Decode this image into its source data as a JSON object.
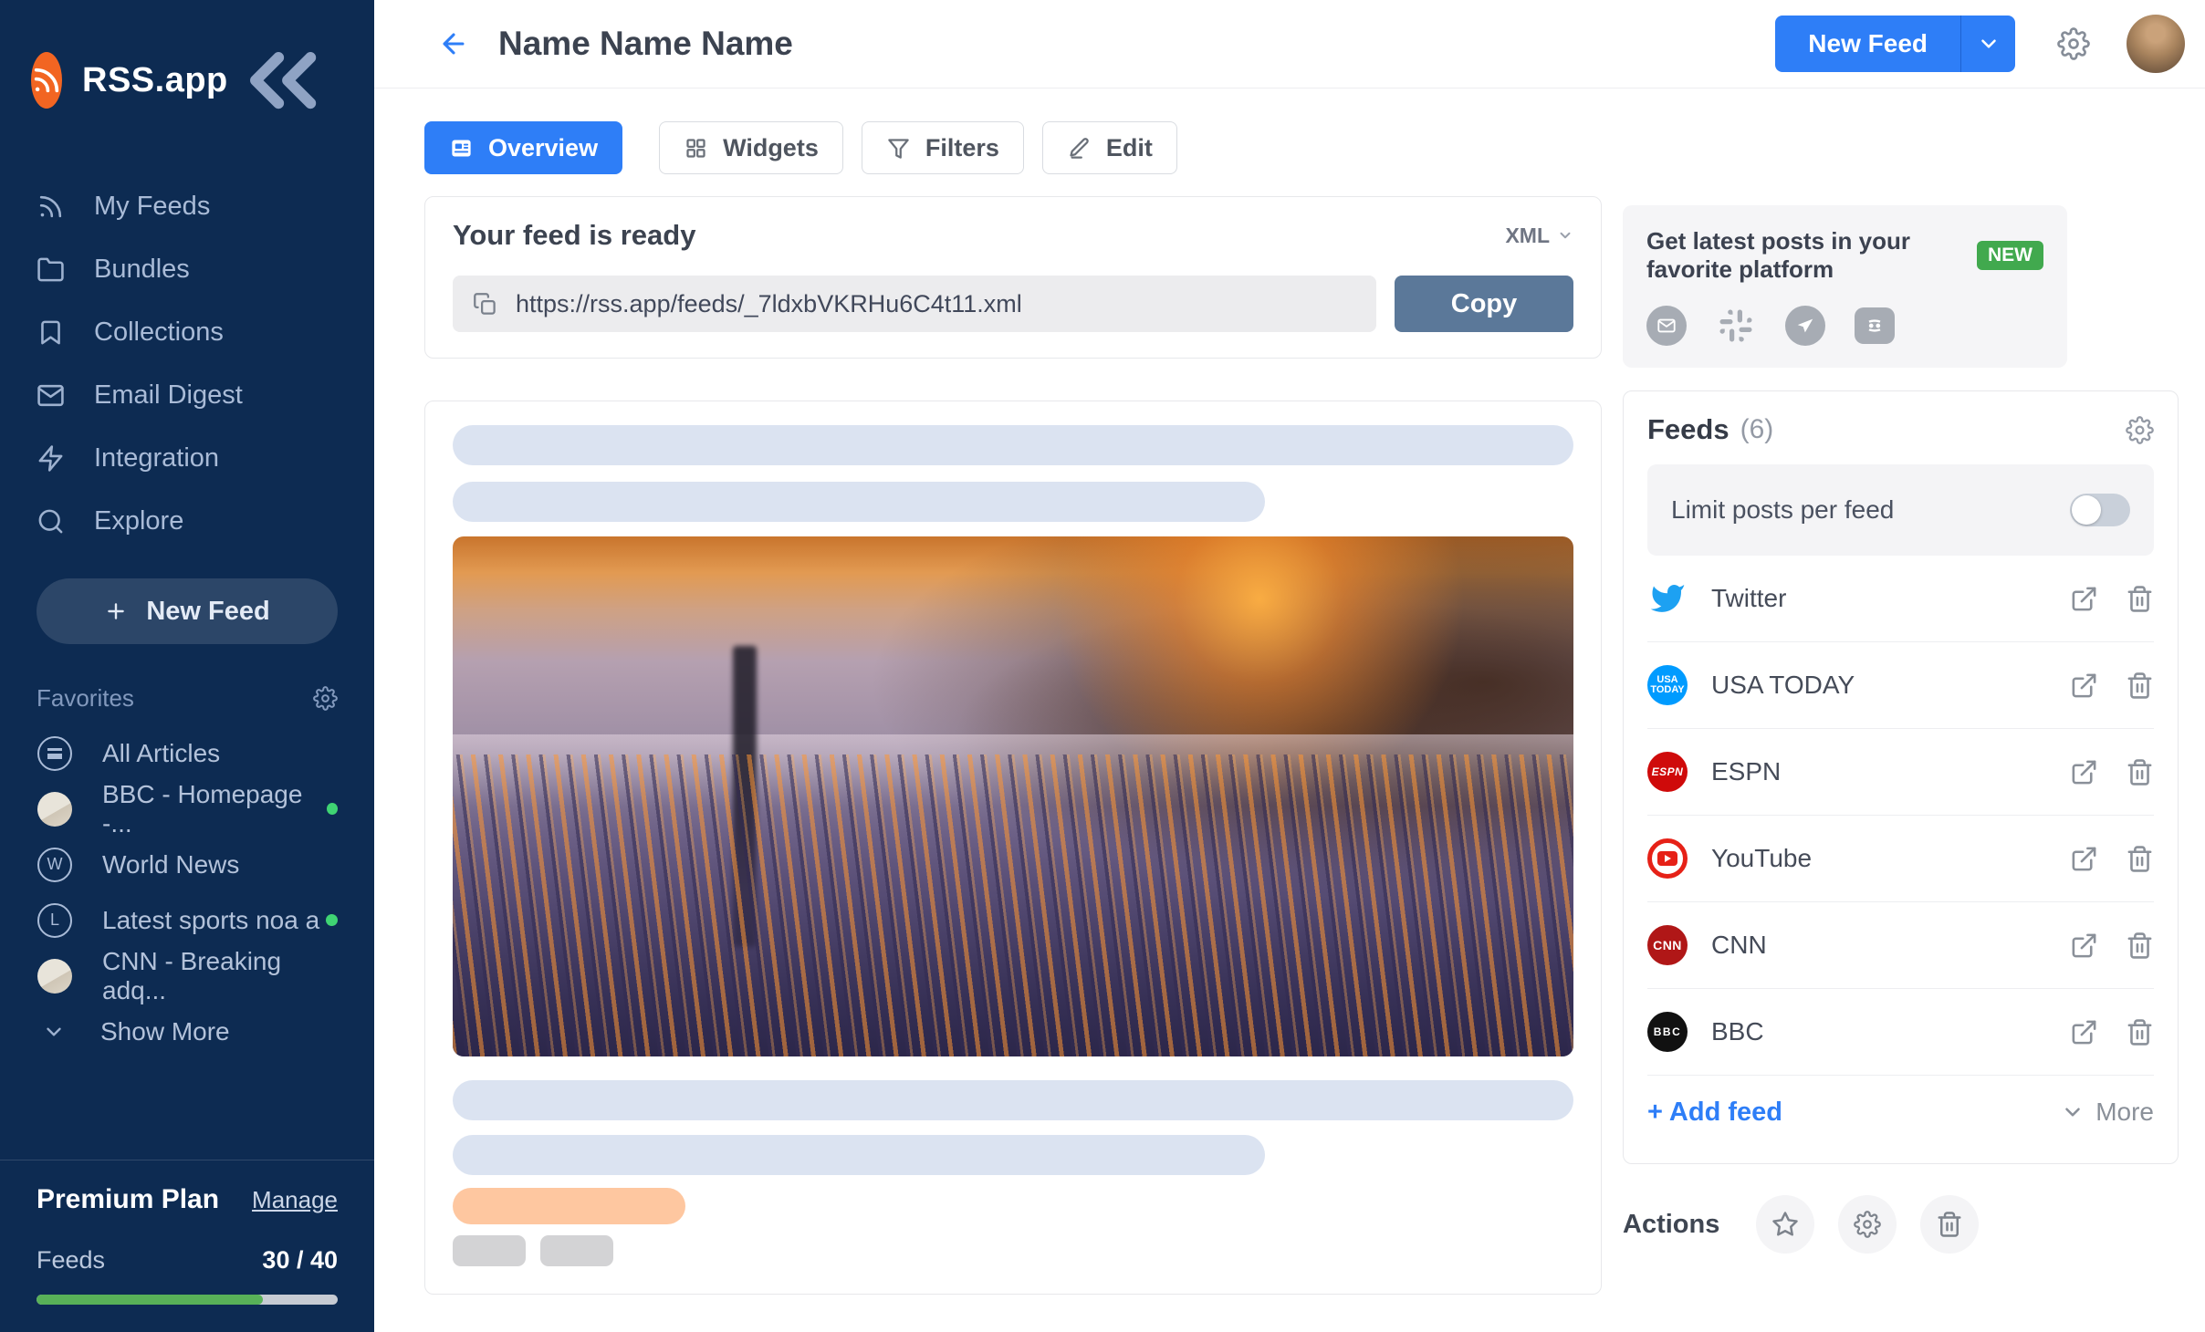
{
  "colors": {
    "accent": "#2e7ef7",
    "sidebar_bg": "#0d2b52",
    "copy_button": "#5b7899",
    "new_badge": "#41a94e",
    "progress_fill": "#58b158",
    "green_dot": "#3fd473"
  },
  "sidebar": {
    "logo_text": "RSS.app",
    "logo_icon": "rss-icon",
    "collapse_icon": "chevrons-left-icon",
    "nav": [
      {
        "label": "My Feeds",
        "icon": "rss-icon"
      },
      {
        "label": "Bundles",
        "icon": "folder-icon"
      },
      {
        "label": "Collections",
        "icon": "bookmark-icon"
      },
      {
        "label": "Email Digest",
        "icon": "mail-icon"
      },
      {
        "label": "Integration",
        "icon": "zap-icon"
      },
      {
        "label": "Explore",
        "icon": "search-icon"
      }
    ],
    "new_feed_label": "New Feed",
    "favorites": {
      "label": "Favorites",
      "settings_icon": "gear-icon",
      "items": [
        {
          "label": "All Articles",
          "icon": "menu-circle",
          "unread": false
        },
        {
          "label": "BBC - Homepage -...",
          "icon": "avatar",
          "unread": true
        },
        {
          "label": "World News",
          "icon": "letter",
          "letter": "W",
          "unread": false
        },
        {
          "label": "Latest sports noa a",
          "icon": "letter",
          "letter": "L",
          "unread": true
        },
        {
          "label": "CNN - Breaking adq...",
          "icon": "avatar",
          "unread": false
        }
      ],
      "show_more": "Show More"
    },
    "plan": {
      "title": "Premium Plan",
      "manage": "Manage",
      "usage_label": "Feeds",
      "usage_value": "30 / 40",
      "progress_pct": 75
    }
  },
  "header": {
    "title": "Name Name Name",
    "new_feed_label": "New Feed"
  },
  "tabs": {
    "items": [
      {
        "label": "Overview",
        "active": true,
        "icon": "article-icon"
      },
      {
        "label": "Widgets",
        "active": false,
        "icon": "grid-icon"
      },
      {
        "label": "Filters",
        "active": false,
        "icon": "funnel-icon"
      },
      {
        "label": "Edit",
        "active": false,
        "icon": "pencil-icon"
      }
    ]
  },
  "feed_ready": {
    "heading": "Your feed is ready",
    "format": "XML",
    "url": "https://rss.app/feeds/_7ldxbVKRHu6C4t11.xml",
    "copy_label": "Copy"
  },
  "platform": {
    "title": "Get latest posts in your favorite platform",
    "badge": "NEW",
    "icons": [
      "email-icon",
      "slack-icon",
      "telegram-icon",
      "discord-icon"
    ]
  },
  "feeds_panel": {
    "title": "Feeds",
    "count": "(6)",
    "settings_icon": "gear-icon",
    "limit_label": "Limit posts per feed",
    "limit_enabled": false,
    "rows": [
      {
        "name": "Twitter",
        "icon": "twitter-icon"
      },
      {
        "name": "USA TODAY",
        "icon": "usa-today-logo",
        "icon_text": "USA TODAY"
      },
      {
        "name": "ESPN",
        "icon": "espn-logo",
        "icon_text": "ESPN"
      },
      {
        "name": "YouTube",
        "icon": "youtube-icon"
      },
      {
        "name": "CNN",
        "icon": "cnn-logo",
        "icon_text": "CNN"
      },
      {
        "name": "BBC",
        "icon": "bbc-logo",
        "icon_text": "BBC"
      }
    ],
    "add_feed": "+ Add feed",
    "more": "More"
  },
  "actions": {
    "label": "Actions",
    "icons": [
      "star-icon",
      "gear-icon",
      "trash-icon"
    ]
  }
}
